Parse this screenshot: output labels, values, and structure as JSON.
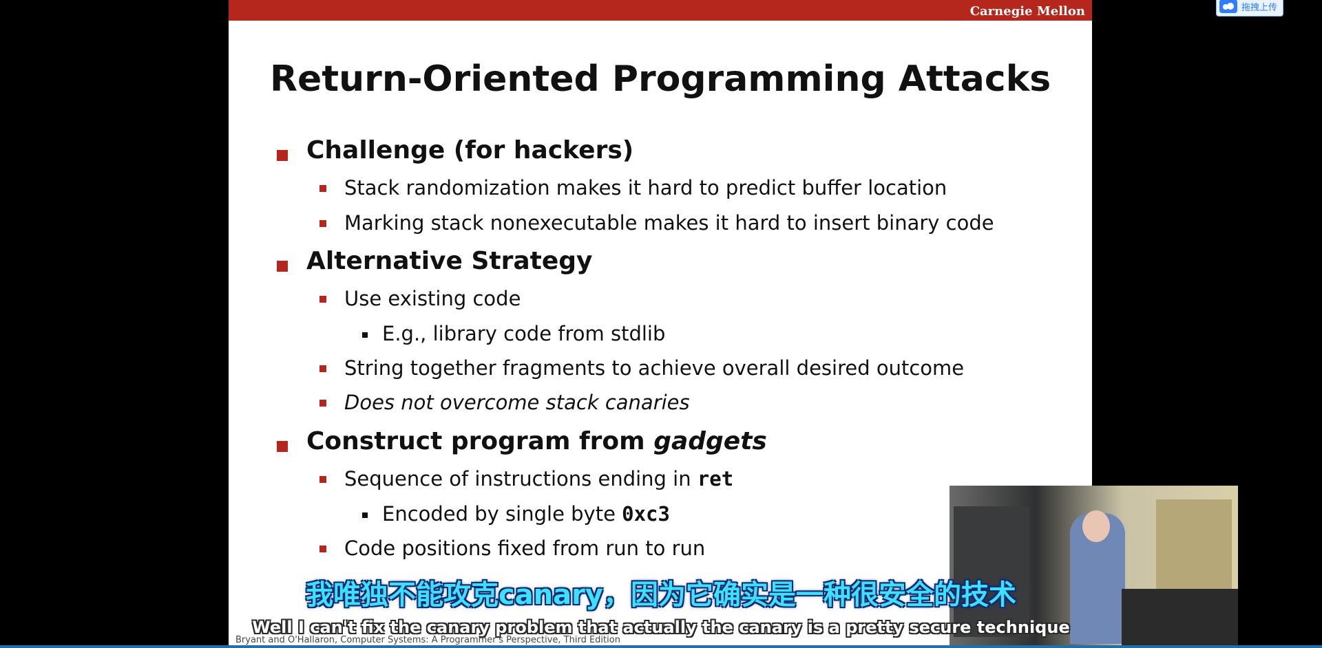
{
  "slide": {
    "header_brand": "Carnegie Mellon",
    "title": "Return-Oriented Programming Attacks",
    "sections": [
      {
        "heading": "Challenge (for hackers)",
        "items": [
          {
            "text": "Stack randomization makes it hard to predict buffer location"
          },
          {
            "text": "Marking stack nonexecutable makes it hard to insert binary code"
          }
        ]
      },
      {
        "heading": "Alternative Strategy",
        "items": [
          {
            "text": "Use existing code",
            "sub": [
              "E.g., library code from stdlib"
            ]
          },
          {
            "text": "String together fragments to achieve overall desired outcome"
          },
          {
            "text": "Does not overcome stack canaries"
          }
        ]
      },
      {
        "heading_prefix": "Construct program from ",
        "heading_emph": "gadgets",
        "items": [
          {
            "text_prefix": "Sequence of instructions ending in ",
            "text_code": "ret",
            "sub_prefix": "Encoded by single byte ",
            "sub_code": "0xc3"
          },
          {
            "text": "Code positions fixed from run to run"
          }
        ]
      }
    ],
    "footer": "Bryant and O'Hallaron, Computer Systems: A Programmer's Perspective, Third Edition"
  },
  "overlay": {
    "upload_label": "拖拽上传",
    "upload_icon": "cloud-upload-icon"
  },
  "subtitles": {
    "chinese": "我唯独不能攻克canary，因为它确实是一种很安全的技术",
    "english": "Well I can't fix the canary problem that actually the canary is a pretty secure technique"
  },
  "colors": {
    "accent_red": "#b5261c",
    "subtitle_cyan": "#3ee0ff",
    "subtitle_outline": "#0b2a6f"
  }
}
